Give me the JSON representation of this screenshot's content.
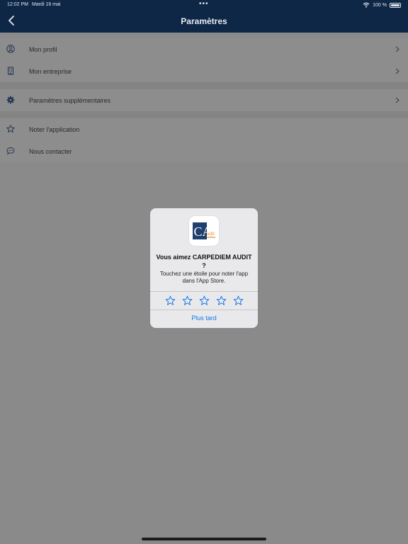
{
  "status_bar": {
    "time": "12:02 PM",
    "date": "Mardi 16 mai",
    "battery_text": "100 %",
    "icons": [
      "wifi-icon",
      "battery-icon"
    ]
  },
  "nav": {
    "title": "Paramètres",
    "back_icon": "chevron-left-icon"
  },
  "settings": {
    "group1": [
      {
        "label": "Mon profil",
        "icon": "person-circle-icon"
      },
      {
        "label": "Mon entreprise",
        "icon": "building-icon"
      }
    ],
    "group2": [
      {
        "label": "Paramètres supplémentaires",
        "icon": "gear-icon"
      }
    ],
    "group3": [
      {
        "label": "Noter l'application",
        "icon": "star-icon"
      },
      {
        "label": "Nous contacter",
        "icon": "chat-bubble-icon"
      }
    ]
  },
  "rating_dialog": {
    "title": "Vous aimez CARPEDIEM AUDIT ?",
    "message": "Touchez une étoile pour noter l'app dans l'App Store.",
    "later_label": "Plus tard",
    "star_count": 5,
    "app_icon": {
      "letters": "CA",
      "suffix": "udit"
    },
    "colors": {
      "accent": "#1677e8",
      "logo_navy": "#1f3f6e",
      "logo_orange": "#e8892a"
    }
  },
  "colors": {
    "navbar": "#0f2747",
    "overlay_background": "#8a8a8a"
  }
}
